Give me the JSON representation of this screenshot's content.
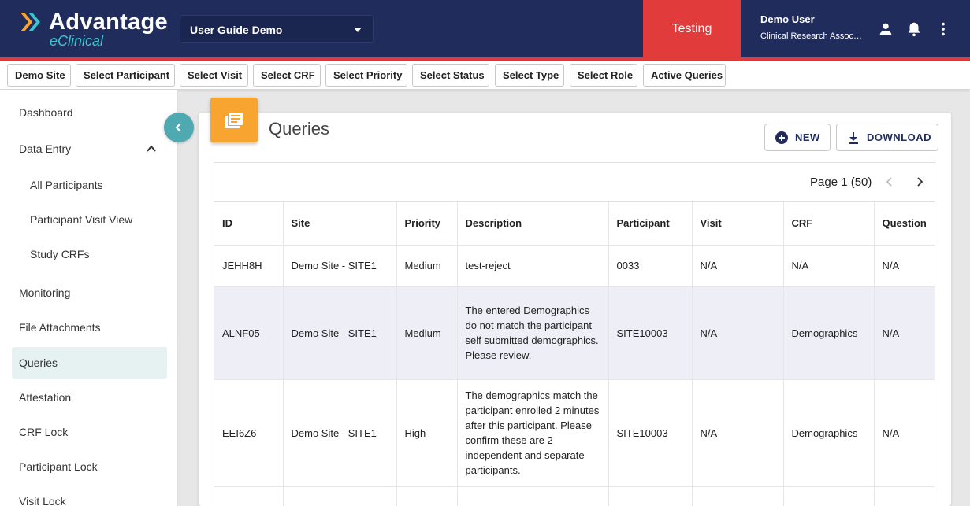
{
  "header": {
    "logo_title": "Advantage",
    "logo_sub": "eClinical",
    "study_select": "User Guide Demo",
    "environment": "Testing",
    "user_name": "Demo User",
    "user_role": "Clinical Research Associate",
    "icons": [
      "person-icon",
      "bell-icon",
      "more-vert-icon"
    ]
  },
  "filters": [
    "Demo Site",
    "Select Participant",
    "Select Visit",
    "Select CRF",
    "Select Priority",
    "Select Status",
    "Select Type",
    "Select Role",
    "Active Queries"
  ],
  "sidebar": {
    "items": [
      {
        "label": "Dashboard"
      },
      {
        "label": "Data Entry"
      },
      {
        "label": "All Participants"
      },
      {
        "label": "Participant Visit View"
      },
      {
        "label": "Study CRFs"
      },
      {
        "label": "Monitoring"
      },
      {
        "label": "File Attachments"
      },
      {
        "label": "Queries"
      },
      {
        "label": "Attestation"
      },
      {
        "label": "CRF Lock"
      },
      {
        "label": "Participant Lock"
      },
      {
        "label": "Visit Lock"
      }
    ],
    "active": "Queries"
  },
  "main": {
    "title": "Queries",
    "new_label": "NEW",
    "download_label": "DOWNLOAD",
    "pager": "Page 1 (50)"
  },
  "table": {
    "columns": [
      "ID",
      "Site",
      "Priority",
      "Description",
      "Participant",
      "Visit",
      "CRF",
      "Question"
    ],
    "rows": [
      [
        "JEHH8H",
        "Demo Site - SITE1",
        "Medium",
        "test-reject",
        "0033",
        "N/A",
        "N/A",
        "N/A"
      ],
      [
        "ALNF05",
        "Demo Site - SITE1",
        "Medium",
        "The entered Demographics do not match the participant self submitted demographics. Please review.",
        "SITE10003",
        "N/A",
        "Demographics",
        "N/A"
      ],
      [
        "EEI6Z6",
        "Demo Site - SITE1",
        "High",
        "The demographics match the participant enrolled 2 minutes after this participant. Please confirm these are 2 independent and separate participants.",
        "SITE10003",
        "N/A",
        "Demographics",
        "N/A"
      ]
    ]
  },
  "colors": {
    "header_bg": "#1f2c5c",
    "accent_red": "#e13b3b",
    "teal": "#4fa9b1",
    "orange": "#f7a530",
    "row_highlight": "#eeeef6"
  }
}
